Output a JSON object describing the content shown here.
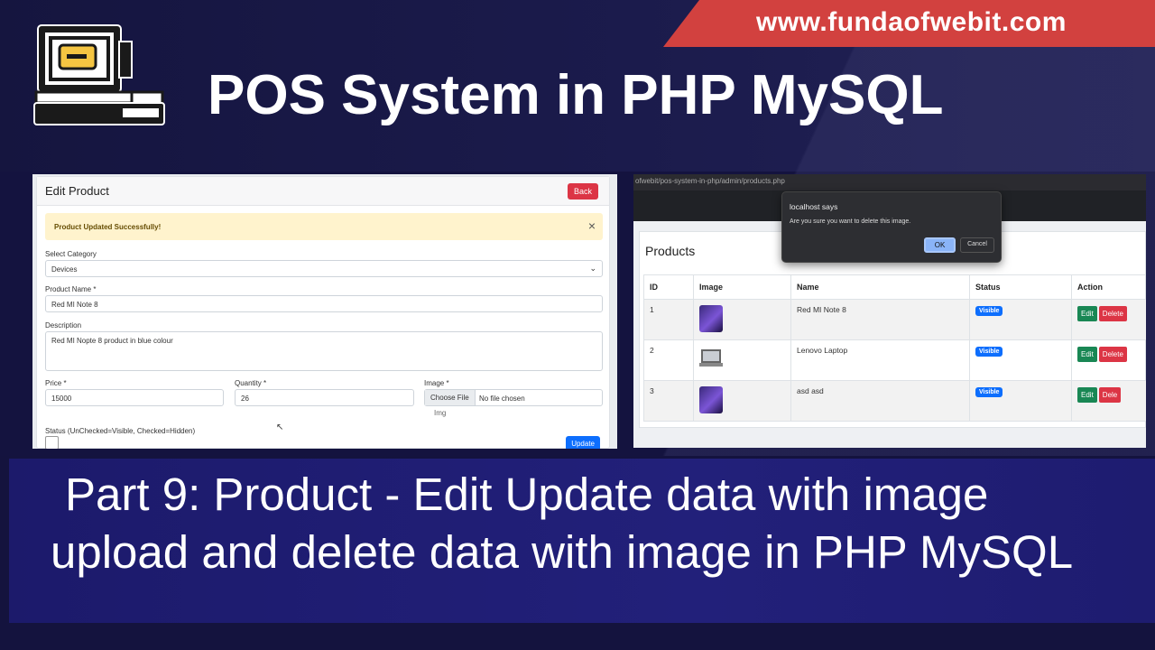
{
  "header": {
    "website": "www.fundaofwebit.com",
    "title": "POS System in PHP MySQL"
  },
  "subtitle": {
    "line1": "Part 9: Product - Edit Update data with image",
    "line2": "upload and delete data with image in PHP MySQL"
  },
  "edit_form": {
    "card_title": "Edit Product",
    "back_label": "Back",
    "alert_text": "Product Updated Successfully!",
    "alert_close": "×",
    "category_label": "Select Category",
    "category_value": "Devices",
    "name_label": "Product Name *",
    "name_value": "Red MI Note 8",
    "description_label": "Description",
    "description_value": "Red MI Nopte 8 product in blue colour",
    "price_label": "Price *",
    "price_value": "15000",
    "quantity_label": "Quantity *",
    "quantity_value": "26",
    "image_label": "Image *",
    "choose_file_label": "Choose File",
    "no_file_text": "No file chosen",
    "img_alt": "Img",
    "status_label": "Status (UnChecked=Visible, Checked=Hidden)",
    "update_label": "Update"
  },
  "products_page": {
    "address": "ofwebit/pos-system-in-php/admin/products.php",
    "title": "Products",
    "columns": [
      "ID",
      "Image",
      "Name",
      "Status",
      "Action"
    ],
    "rows": [
      {
        "id": "1",
        "image": "phone",
        "name": "Red MI Note 8",
        "status": "Visible",
        "edit": "Edit",
        "delete": "Delete"
      },
      {
        "id": "2",
        "image": "laptop",
        "name": "Lenovo Laptop",
        "status": "Visible",
        "edit": "Edit",
        "delete": "Delete"
      },
      {
        "id": "3",
        "image": "phone",
        "name": "asd asd",
        "status": "Visible",
        "edit": "Edit",
        "delete": "Dele"
      }
    ],
    "dialog": {
      "title": "localhost says",
      "message": "Are you sure you want to delete this image.",
      "ok_label": "OK",
      "cancel_label": "Cancel"
    }
  },
  "colors": {
    "ribbon": "#d2413f",
    "background": "#14133f",
    "banner": "#1e1c70"
  },
  "icons": {
    "logo": "pos-terminal-icon"
  }
}
